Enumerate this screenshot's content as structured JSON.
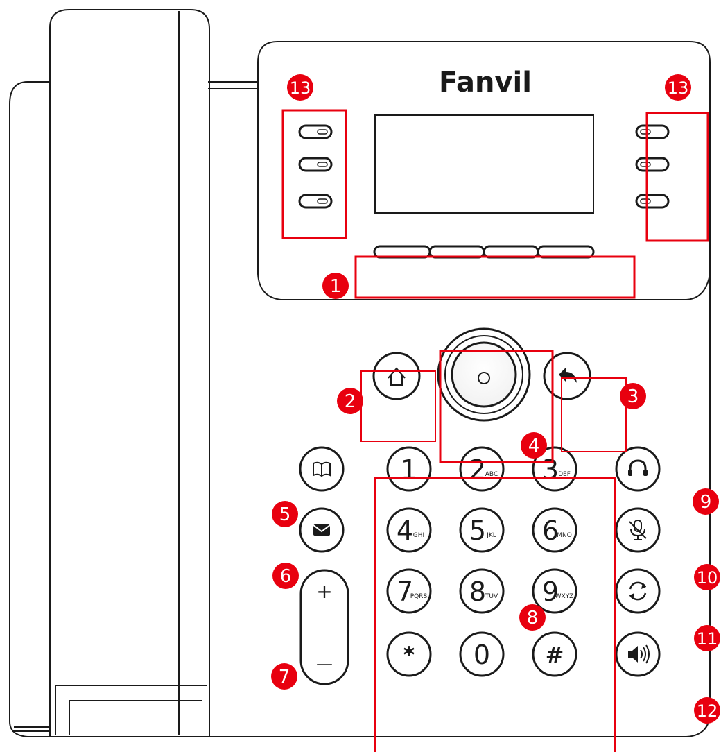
{
  "brand": "Fanvil",
  "colors": {
    "callout": "#e8000f",
    "line": "#1a1a1a",
    "body": "#ffffff"
  },
  "callouts": [
    "1",
    "2",
    "3",
    "4",
    "5",
    "6",
    "7",
    "8",
    "9",
    "10",
    "11",
    "12",
    "13",
    "13"
  ],
  "keypad": {
    "digits": [
      "1",
      "2",
      "3",
      "4",
      "5",
      "6",
      "7",
      "8",
      "9",
      "*",
      "0",
      "#"
    ],
    "letters": [
      "",
      "ABC",
      "DEF",
      "GHI",
      "JKL",
      "MNO",
      "PQRS",
      "TUV",
      "WXYZ",
      "",
      "",
      ""
    ]
  },
  "nav": {
    "ok_symbol": "○"
  },
  "keys": {
    "volume_up": "+",
    "volume_down": "—"
  },
  "icons": {
    "home": "home-icon",
    "back": "back-arrow-icon",
    "phonebook": "book-icon",
    "message": "envelope-icon",
    "headset": "headset-icon",
    "mute": "mic-mute-icon",
    "transfer": "transfer-icon",
    "speaker": "speaker-icon"
  }
}
